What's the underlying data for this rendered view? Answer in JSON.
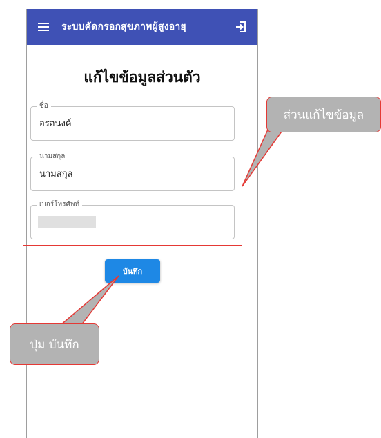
{
  "appbar": {
    "title": "ระบบคัดกรอกสุขภาพผู้สูงอายุ",
    "menu_icon": "hamburger-menu-icon",
    "logout_icon": "logout-icon",
    "color": "#3f51b5"
  },
  "page": {
    "title": "แก้ไขข้อมูลส่วนตัว"
  },
  "form": {
    "first_name": {
      "label": "ชื่อ",
      "value": "อรอนงค์"
    },
    "last_name": {
      "label": "นามสกุล",
      "value": "นามสกุล"
    },
    "phone": {
      "label": "เบอร์โทรศัพท์",
      "value": ""
    },
    "save_label": "บันทึก",
    "save_color": "#1e88e5"
  },
  "annotations": {
    "form_callout": "ส่วนแก้ไขข้อมูล",
    "button_callout": "ปุ่ม บันทึก",
    "highlight_color": "#e53935"
  }
}
